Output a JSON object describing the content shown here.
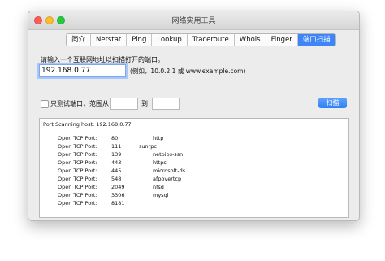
{
  "window": {
    "title": "网络实用工具"
  },
  "tabs": [
    "简介",
    "Netstat",
    "Ping",
    "Lookup",
    "Traceroute",
    "Whois",
    "Finger",
    "端口扫描"
  ],
  "active_tab": 7,
  "form": {
    "prompt": "请输入一个互联网地址以扫描打开的端口。",
    "address_value": "192.168.0.77",
    "example": "(例如，10.0.2.1 或 www.example.com)",
    "only_test_label": "只测试端口，范围从",
    "to_label": "到",
    "range_from_value": "",
    "range_to_value": "",
    "scan_button": "扫描"
  },
  "output": {
    "header": "Port Scanning host: 192.168.0.77",
    "rows": [
      {
        "label": "Open TCP Port:",
        "port": "80",
        "service": "http"
      },
      {
        "label": "Open TCP Port:",
        "port": "111",
        "service": "sunrpc"
      },
      {
        "label": "Open TCP Port:",
        "port": "139",
        "service": "netbios-ssn"
      },
      {
        "label": "Open TCP Port:",
        "port": "443",
        "service": "https"
      },
      {
        "label": "Open TCP Port:",
        "port": "445",
        "service": "microsoft-ds"
      },
      {
        "label": "Open TCP Port:",
        "port": "548",
        "service": "afpovertcp"
      },
      {
        "label": "Open TCP Port:",
        "port": "2049",
        "service": "nfsd"
      },
      {
        "label": "Open TCP Port:",
        "port": "3306",
        "service": "mysql"
      },
      {
        "label": "Open TCP Port:",
        "port": "8181",
        "service": ""
      }
    ]
  }
}
